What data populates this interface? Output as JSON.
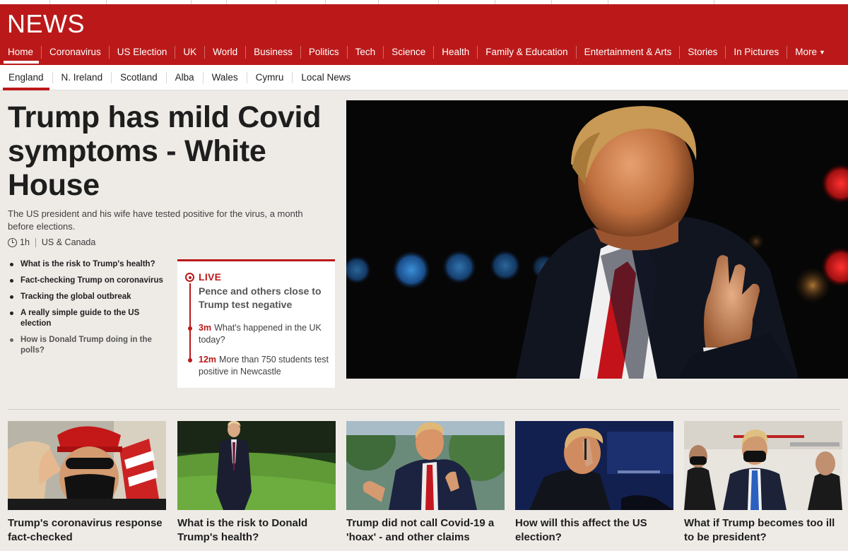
{
  "header": {
    "logo": "NEWS",
    "nav": [
      "Home",
      "Coronavirus",
      "US Election",
      "UK",
      "World",
      "Business",
      "Politics",
      "Tech",
      "Science",
      "Health",
      "Family & Education",
      "Entertainment & Arts",
      "Stories",
      "In Pictures"
    ],
    "more_label": "More",
    "active_nav": "Home",
    "brand_color": "#bb1919"
  },
  "subnav": {
    "items": [
      "England",
      "N. Ireland",
      "Scotland",
      "Alba",
      "Wales",
      "Cymru",
      "Local News"
    ],
    "active": "England"
  },
  "top_story": {
    "headline": "Trump has mild Covid symptoms - White House",
    "summary": "The US president and his wife have tested positive for the virus, a month before elections.",
    "time": "1h",
    "section": "US & Canada",
    "related": [
      "What is the risk to Trump's health?",
      "Fact-checking Trump on coronavirus",
      "Tracking the global outbreak",
      "A really simple guide to the US election",
      "How is Donald Trump doing in the polls?"
    ]
  },
  "live": {
    "label": "LIVE",
    "title": "Pence and others close to Trump test negative",
    "entries": [
      {
        "time": "3m",
        "text": "What's happened in the UK today?"
      },
      {
        "time": "12m",
        "text": "More than 750 students test positive in Newcastle"
      }
    ]
  },
  "cards": [
    {
      "title": "Trump's coronavirus response fact-checked"
    },
    {
      "title": "What is the risk to Donald Trump's health?"
    },
    {
      "title": "Trump did not call Covid-19 a 'hoax' - and other claims"
    },
    {
      "title": "How will this affect the US election?"
    },
    {
      "title": "What if Trump becomes too ill to be president?"
    }
  ]
}
